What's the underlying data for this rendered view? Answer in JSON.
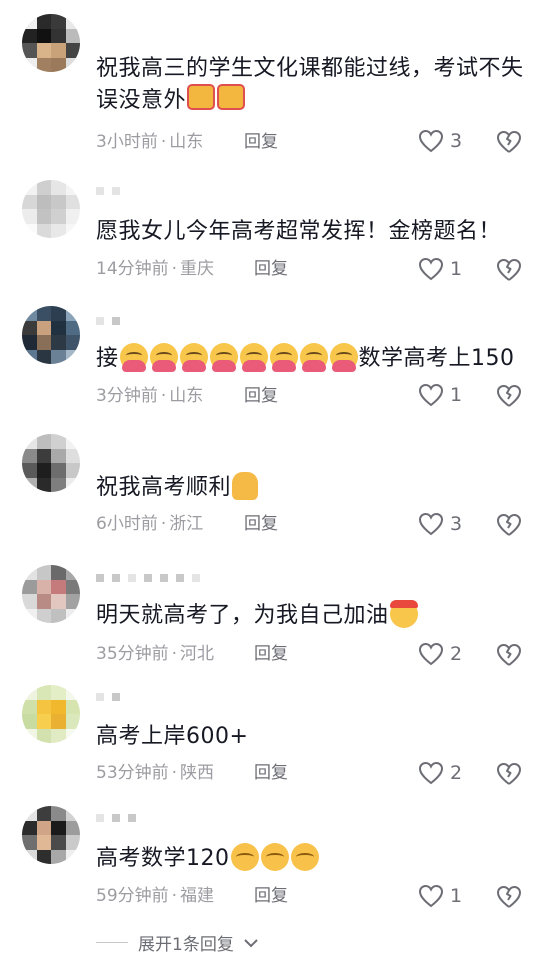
{
  "comments": [
    {
      "text": "祝我高三的学生文化课都能过线，考试不失误没意外",
      "emojis": [
        "box",
        "box"
      ],
      "time": "3小时前",
      "location": "山东",
      "reply": "回复",
      "likes": "3"
    },
    {
      "text": "愿我女儿今年高考超常发挥！金榜题名！",
      "emojis": [],
      "time": "14分钟前",
      "location": "重庆",
      "reply": "回复",
      "likes": "1"
    },
    {
      "text": "接",
      "text_after": "数学高考上150",
      "emojis": [
        "hug",
        "hug",
        "hug",
        "hug",
        "hug",
        "hug",
        "hug",
        "hug"
      ],
      "time": "3分钟前",
      "location": "山东",
      "reply": "回复",
      "likes": "1"
    },
    {
      "text": "祝我高考顺利",
      "emojis": [
        "hands"
      ],
      "time": "6小时前",
      "location": "浙江",
      "reply": "回复",
      "likes": "3"
    },
    {
      "text": "明天就高考了，为我自己加油",
      "emojis": [
        "fist"
      ],
      "time": "35分钟前",
      "location": "河北",
      "reply": "回复",
      "likes": "2"
    },
    {
      "text": "高考上岸600+",
      "emojis": [],
      "time": "53分钟前",
      "location": "陕西",
      "reply": "回复",
      "likes": "2"
    },
    {
      "text": "高考数学120",
      "emojis": [
        "clench",
        "clench",
        "clench"
      ],
      "time": "59分钟前",
      "location": "福建",
      "reply": "回复",
      "likes": "1"
    }
  ],
  "meta_separator": "·",
  "expand_label": "展开1条回复",
  "colors": {
    "text": "#161823",
    "meta": "#9c9ca2",
    "icon": "#6d6e75"
  },
  "icons": {
    "like": "heart-outline-icon",
    "dislike": "broken-heart-icon",
    "expand": "chevron-down-icon"
  }
}
